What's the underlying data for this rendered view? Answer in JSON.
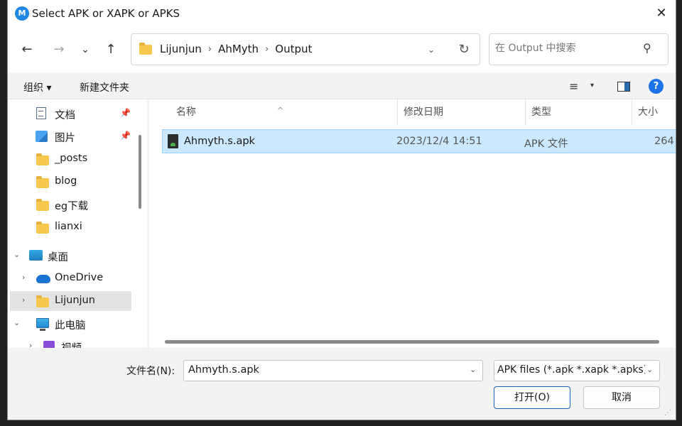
{
  "window": {
    "title": "Select APK or XAPK or APKS",
    "app_icon_text": "M",
    "close_glyph": "✕"
  },
  "nav": {
    "back_glyph": "←",
    "forward_glyph": "→",
    "recent_glyph": "⌄",
    "up_glyph": "↑",
    "breadcrumbs": [
      "Lijunjun",
      "AhMyth",
      "Output"
    ],
    "breadcrumb_sep": "›",
    "dropdown_glyph": "⌄",
    "refresh_glyph": "↻"
  },
  "search": {
    "placeholder": "在 Output 中搜索",
    "icon_glyph": "⚲"
  },
  "commands": {
    "organize": "组织 ▾",
    "new_folder": "新建文件夹",
    "view_glyph": "≡",
    "view_caret": "▾",
    "help_glyph": "?"
  },
  "sidebar": {
    "items": [
      {
        "label": "文档",
        "icon": "document-icon",
        "pinned": true
      },
      {
        "label": "图片",
        "icon": "picture-icon",
        "pinned": true
      },
      {
        "label": "_posts",
        "icon": "folder-icon"
      },
      {
        "label": "blog",
        "icon": "folder-icon"
      },
      {
        "label": "eg下载",
        "icon": "folder-icon"
      },
      {
        "label": "lianxi",
        "icon": "folder-icon"
      },
      {
        "label": "桌面",
        "icon": "desktop-icon",
        "chevron": "⌄"
      },
      {
        "label": "OneDrive",
        "icon": "onedrive-icon",
        "chevron": "›"
      },
      {
        "label": "Lijunjun",
        "icon": "folder-icon",
        "chevron": "›",
        "selected": true
      },
      {
        "label": "此电脑",
        "icon": "pc-icon",
        "chevron": "⌄"
      },
      {
        "label": "视频",
        "icon": "video-icon",
        "chevron": "›"
      }
    ],
    "pin_glyph": "📌"
  },
  "columns": {
    "name": "名称",
    "modified": "修改日期",
    "type": "类型",
    "size": "大小",
    "sort_glyph": "^"
  },
  "files": [
    {
      "name": "Ahmyth.s.apk",
      "modified": "2023/12/4 14:51",
      "type": "APK 文件",
      "size": "264",
      "icon": "apk-file-icon",
      "selected": true
    }
  ],
  "footer": {
    "filename_label": "文件名(N):",
    "filename_value": "Ahmyth.s.apk",
    "filetype_value": "APK files (*.apk *.xapk *.apks)",
    "open_label": "打开(O)",
    "cancel_label": "取消",
    "caret_glyph": "⌄"
  }
}
